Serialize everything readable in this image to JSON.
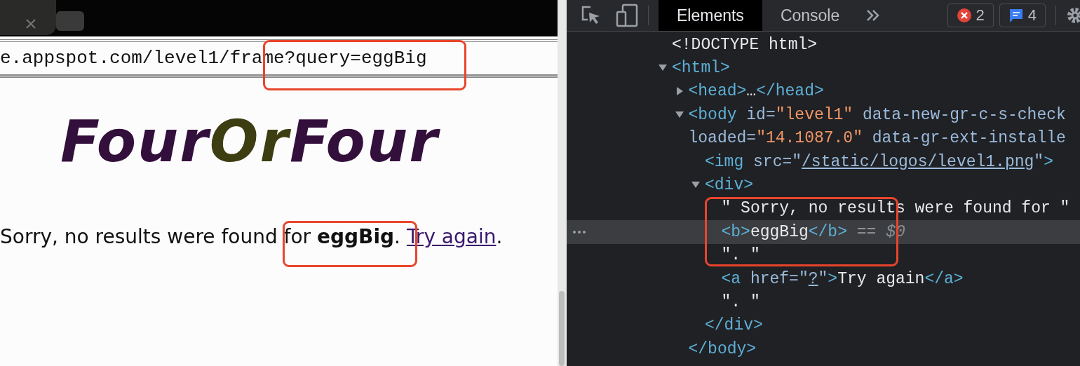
{
  "browser": {
    "address": "e.appspot.com/level1/frame?query=eggBig"
  },
  "page": {
    "logo": [
      {
        "text": "Four",
        "color": "#330f3b"
      },
      {
        "text": "Or",
        "color": "#3d3d12"
      },
      {
        "text": "Four",
        "color": "#330f3b"
      }
    ],
    "message": "Sorry, no results were found for **eggBig**. ",
    "link": "Try again",
    "after": "."
  },
  "devtools": {
    "tabs": [
      {
        "label": "Elements",
        "selected": true
      },
      {
        "label": "Console",
        "selected": false
      }
    ],
    "errors": "2",
    "messages": "4",
    "tree": [
      {
        "lines": [
          [
            {
              "kind": "text",
              "t": "<!DOCTYPE html>"
            }
          ]
        ]
      },
      {
        "expanded": true,
        "lines": [
          [
            {
              "kind": "tag",
              "t": "<html>"
            }
          ]
        ],
        "children": [
          {
            "expanded": false,
            "lines": [
              [
                {
                  "kind": "tag",
                  "t": "<head>"
                },
                {
                  "kind": "text",
                  "t": "…"
                },
                {
                  "kind": "tag",
                  "t": "</head>"
                }
              ]
            ]
          },
          {
            "expanded": true,
            "lines": [
              [
                {
                  "kind": "tag",
                  "t": "<body"
                },
                {
                  "kind": "attr",
                  "t": " id="
                },
                {
                  "kind": "value",
                  "t": "\"level1\""
                },
                {
                  "kind": "attr",
                  "t": " data-new-gr-c-s-check"
                }
              ],
              [
                {
                  "kind": "attr",
                  "t": "loaded="
                },
                {
                  "kind": "value",
                  "t": "\"14.1087.0\""
                },
                {
                  "kind": "attr",
                  "t": " data-gr-ext-installe"
                }
              ]
            ],
            "closing": [
              {
                "kind": "tag",
                "t": "</body>"
              }
            ],
            "children": [
              {
                "lines": [
                  [
                    {
                      "kind": "tag",
                      "t": "<img"
                    },
                    {
                      "kind": "attr",
                      "t": " src=\""
                    },
                    {
                      "kind": "link",
                      "t": "/static/logos/level1.png"
                    },
                    {
                      "kind": "attr",
                      "t": "\""
                    },
                    {
                      "kind": "tag",
                      "t": ">"
                    }
                  ]
                ]
              },
              {
                "expanded": true,
                "lines": [
                  [
                    {
                      "kind": "tag",
                      "t": "<div>"
                    }
                  ]
                ],
                "closing": [
                  {
                    "kind": "tag",
                    "t": "</div>"
                  }
                ],
                "children": [
                  {
                    "selected": false,
                    "lines": [
                      [
                        {
                          "kind": "text",
                          "t": "\" Sorry, no results were found for \""
                        }
                      ]
                    ]
                  },
                  {
                    "selected": true,
                    "lines": [
                      [
                        {
                          "kind": "tag",
                          "t": "<b>"
                        },
                        {
                          "kind": "text",
                          "t": "eggBig"
                        },
                        {
                          "kind": "tag",
                          "t": "</b>"
                        },
                        {
                          "kind": "hint",
                          "t": " == "
                        },
                        {
                          "kind": "dim",
                          "t": "$0"
                        }
                      ]
                    ]
                  },
                  {
                    "selected": false,
                    "lines": [
                      [
                        {
                          "kind": "text",
                          "t": "\". \""
                        }
                      ]
                    ]
                  },
                  {
                    "selected": false,
                    "lines": [
                      [
                        {
                          "kind": "tag",
                          "t": "<a"
                        },
                        {
                          "kind": "attr",
                          "t": " href=\""
                        },
                        {
                          "kind": "link",
                          "t": "?"
                        },
                        {
                          "kind": "attr",
                          "t": "\""
                        },
                        {
                          "kind": "tag",
                          "t": ">"
                        },
                        {
                          "kind": "text",
                          "t": "Try again"
                        },
                        {
                          "kind": "tag",
                          "t": "</a>"
                        }
                      ]
                    ]
                  },
                  {
                    "selected": false,
                    "lines": [
                      [
                        {
                          "kind": "text",
                          "t": "\". \""
                        }
                      ]
                    ]
                  }
                ]
              }
            ]
          }
        ]
      }
    ]
  }
}
